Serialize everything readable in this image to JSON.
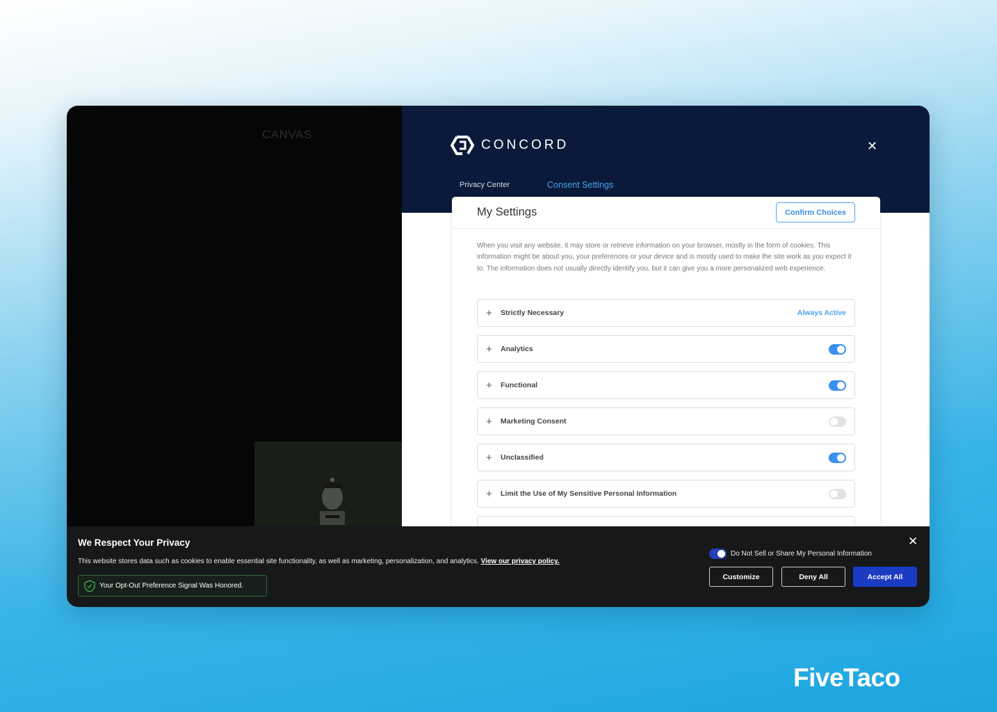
{
  "background_page": {
    "canvas_label": "CANVAS"
  },
  "privacy_center": {
    "logo_text": "CONCORD",
    "tabs": [
      {
        "label": "Privacy Center",
        "active": false
      },
      {
        "label": "Consent Settings",
        "active": true
      }
    ],
    "close_icon": "close-icon",
    "settings": {
      "title": "My Settings",
      "confirm_label": "Confirm Choices",
      "description": "When you visit any website, it may store or retrieve information on your browser, mostly in the form of cookies. This information might be about you, your preferences or your device and is mostly used to make the site work as you expect it to. The information does not usually directly identify you, but it can give you a more personalized web experience.",
      "categories": [
        {
          "label": "Strictly Necessary",
          "status": "Always Active"
        },
        {
          "label": "Analytics",
          "enabled": true
        },
        {
          "label": "Functional",
          "enabled": true
        },
        {
          "label": "Marketing Consent",
          "enabled": false
        },
        {
          "label": "Unclassified",
          "enabled": true
        },
        {
          "label": "Limit the Use of My Sensitive Personal Information",
          "enabled": false
        }
      ]
    }
  },
  "banner": {
    "title": "We Respect Your Privacy",
    "text": "This website stores data such as cookies to enable essential site functionality, as well as marketing, personalization, and analytics.",
    "policy_link": "View our privacy policy.",
    "signal_notice": "Your Opt-Out Preference Signal Was Honored.",
    "do_not_sell_label": "Do Not Sell or Share My Personal Information",
    "do_not_sell_enabled": true,
    "buttons": {
      "customize": "Customize",
      "deny": "Deny All",
      "accept": "Accept All"
    }
  },
  "watermark": "FiveTaco",
  "colors": {
    "navy": "#0b1a3a",
    "accent": "#3b8ff0",
    "accept": "#1b3bc4"
  }
}
